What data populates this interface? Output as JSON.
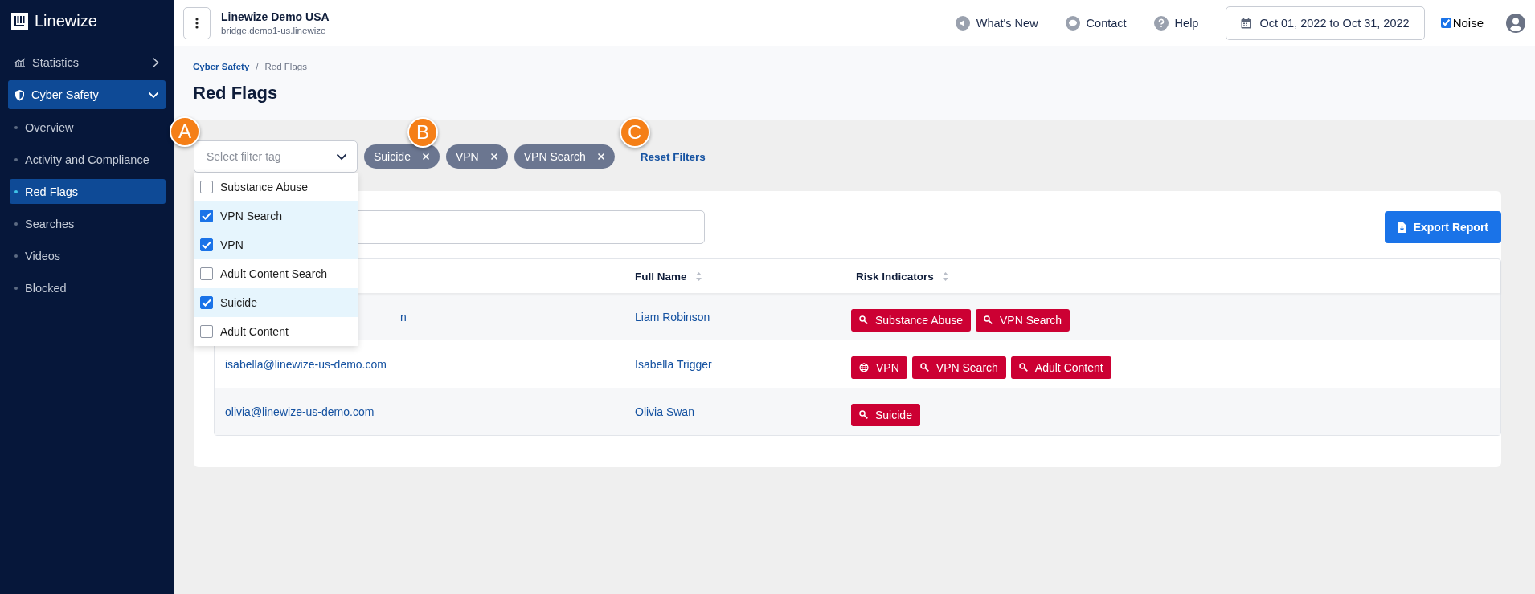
{
  "sidebar": {
    "brand": "Linewize",
    "items": [
      {
        "label": "Statistics",
        "expanded": false,
        "selected": false
      },
      {
        "label": "Cyber Safety",
        "expanded": true,
        "selected": true,
        "children": [
          {
            "label": "Overview",
            "selected": false
          },
          {
            "label": "Activity and Compliance",
            "selected": false
          },
          {
            "label": "Red Flags",
            "selected": true
          },
          {
            "label": "Searches",
            "selected": false
          },
          {
            "label": "Videos",
            "selected": false
          },
          {
            "label": "Blocked",
            "selected": false
          }
        ]
      }
    ]
  },
  "header": {
    "org_name": "Linewize Demo USA",
    "org_host": "bridge.demo1-us.linewize",
    "links": [
      "What's New",
      "Contact",
      "Help"
    ],
    "date_range": "Oct 01, 2022 to Oct 31, 2022",
    "noise": {
      "label": "Noise",
      "checked": true
    }
  },
  "breadcrumb": {
    "items": [
      "Cyber Safety",
      "Red Flags"
    ],
    "separator": "/"
  },
  "title": "Red Flags",
  "filter": {
    "placeholder": "Select filter tag",
    "callout": "A",
    "options": [
      {
        "label": "Substance Abuse",
        "checked": false
      },
      {
        "label": "VPN Search",
        "checked": true
      },
      {
        "label": "VPN",
        "checked": true
      },
      {
        "label": "Adult Content Search",
        "checked": false
      },
      {
        "label": "Suicide",
        "checked": true
      },
      {
        "label": "Adult Content",
        "checked": false
      }
    ],
    "chips": [
      {
        "label": "Suicide",
        "callout": "B"
      },
      {
        "label": "VPN"
      },
      {
        "label": "VPN Search"
      }
    ],
    "reset": {
      "label": "Reset Filters",
      "callout": "C"
    }
  },
  "export_button": "Export Report",
  "table": {
    "columns": [
      {
        "label": "Full Name",
        "sortable": true
      },
      {
        "label": "Risk Indicators",
        "sortable": true
      }
    ],
    "rows": [
      {
        "email": "n",
        "partly_hidden": true,
        "full_name": "Liam Robinson",
        "tags": [
          {
            "label": "Substance Abuse",
            "kind": "search"
          },
          {
            "label": "VPN Search",
            "kind": "search"
          }
        ]
      },
      {
        "email": "isabella@linewize-us-demo.com",
        "full_name": "Isabella Trigger",
        "tags": [
          {
            "label": "VPN",
            "kind": "web"
          },
          {
            "label": "VPN Search",
            "kind": "search"
          },
          {
            "label": "Adult Content",
            "kind": "search"
          }
        ]
      },
      {
        "email": "olivia@linewize-us-demo.com",
        "full_name": "Olivia Swan",
        "tags": [
          {
            "label": "Suicide",
            "kind": "search"
          }
        ]
      }
    ]
  }
}
